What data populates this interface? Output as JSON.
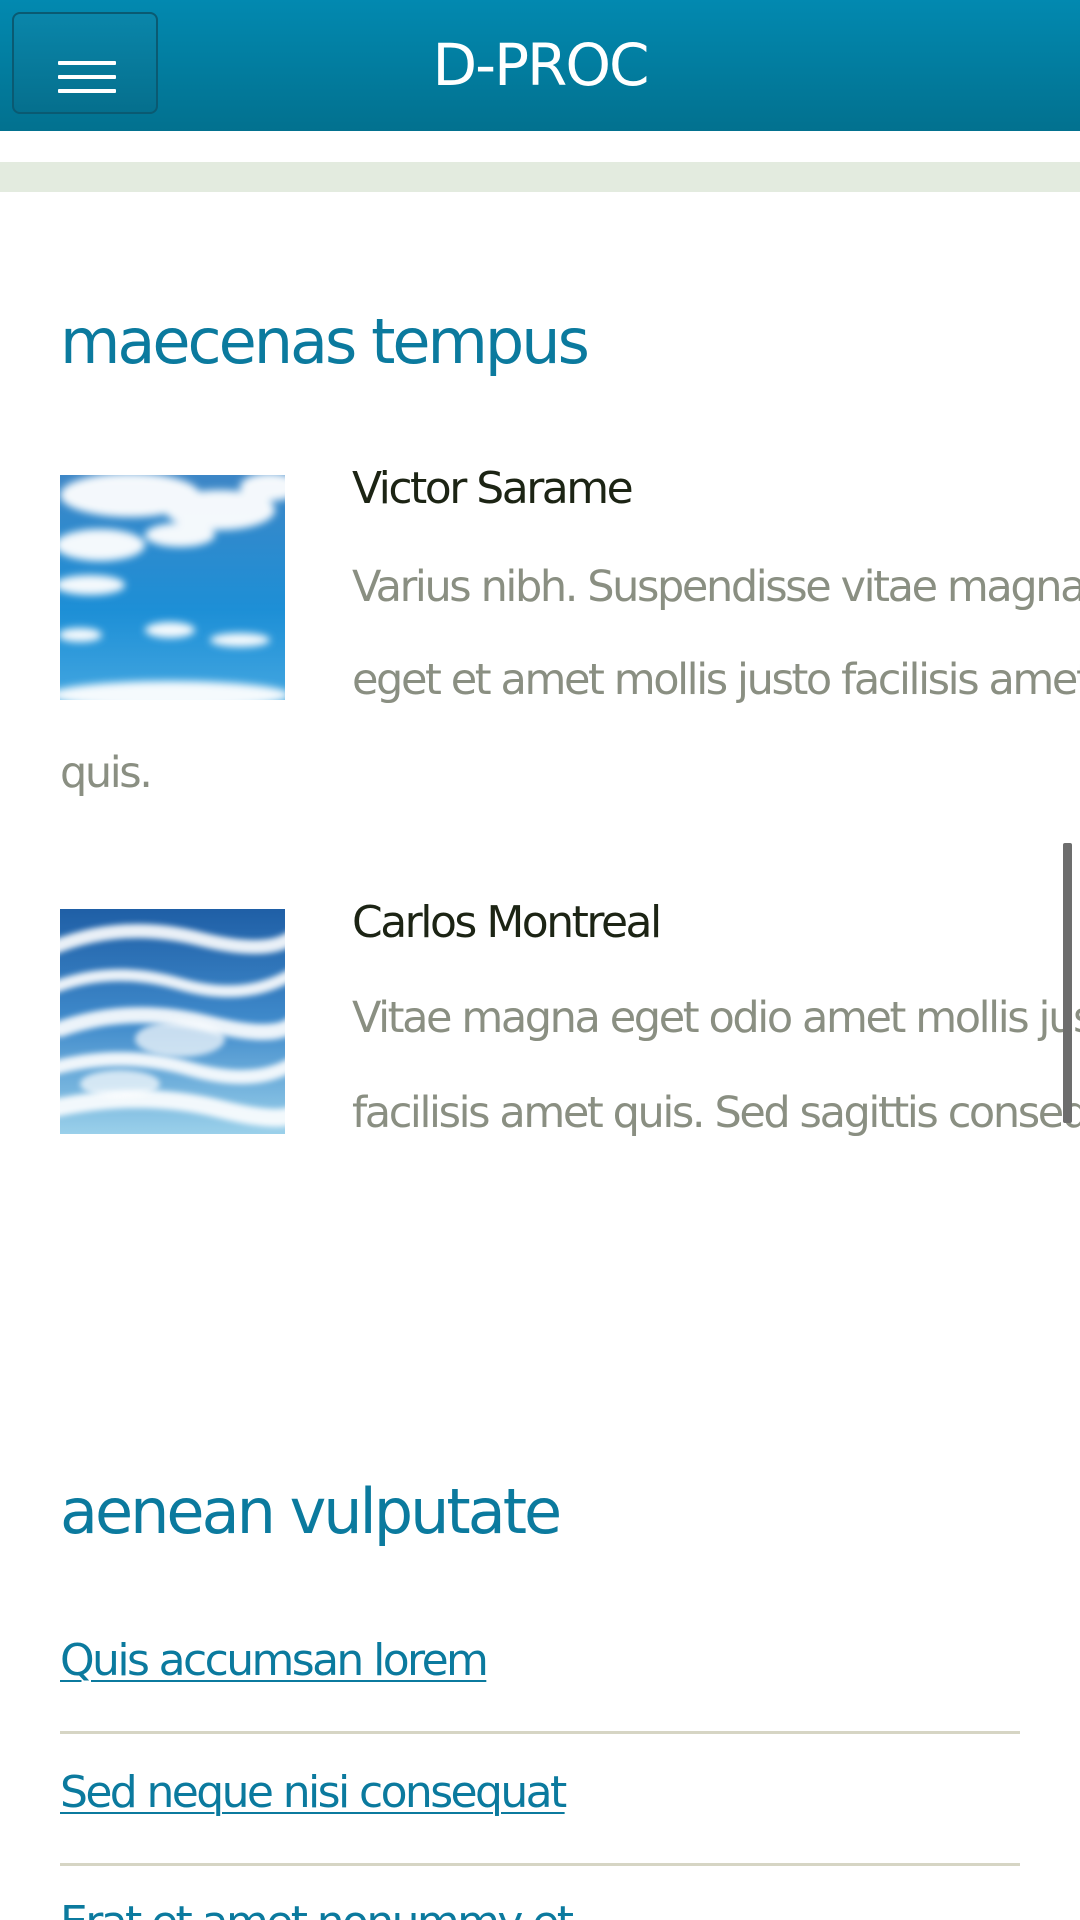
{
  "header": {
    "title": "D-PROC",
    "menu_icon": "hamburger-menu-icon"
  },
  "colors": {
    "header_blue": "#027fa3",
    "title_blue": "#0b7a9e",
    "body_gray": "#8a8f82",
    "name_dark": "#1c2414",
    "strip_green": "#e3ebdf"
  },
  "sections": {
    "testimonials": {
      "title": "maecenas tempus",
      "items": [
        {
          "name": "Victor Sarame",
          "lines": [
            "Varius nibh. Suspendisse vitae magna",
            "eget et amet mollis justo facilisis amet",
            "quis."
          ],
          "image": "sky-clouds-image"
        },
        {
          "name": "Carlos Montreal",
          "lines": [
            "Vitae magna eget odio amet mollis justo",
            "facilisis amet quis. Sed sagittis consequat."
          ],
          "image": "wispy-clouds-image"
        }
      ]
    },
    "links": {
      "title": "aenean vulputate",
      "items": [
        "Quis accumsan lorem",
        "Sed neque nisi consequat",
        "Erat et amet nonummy et"
      ]
    }
  }
}
